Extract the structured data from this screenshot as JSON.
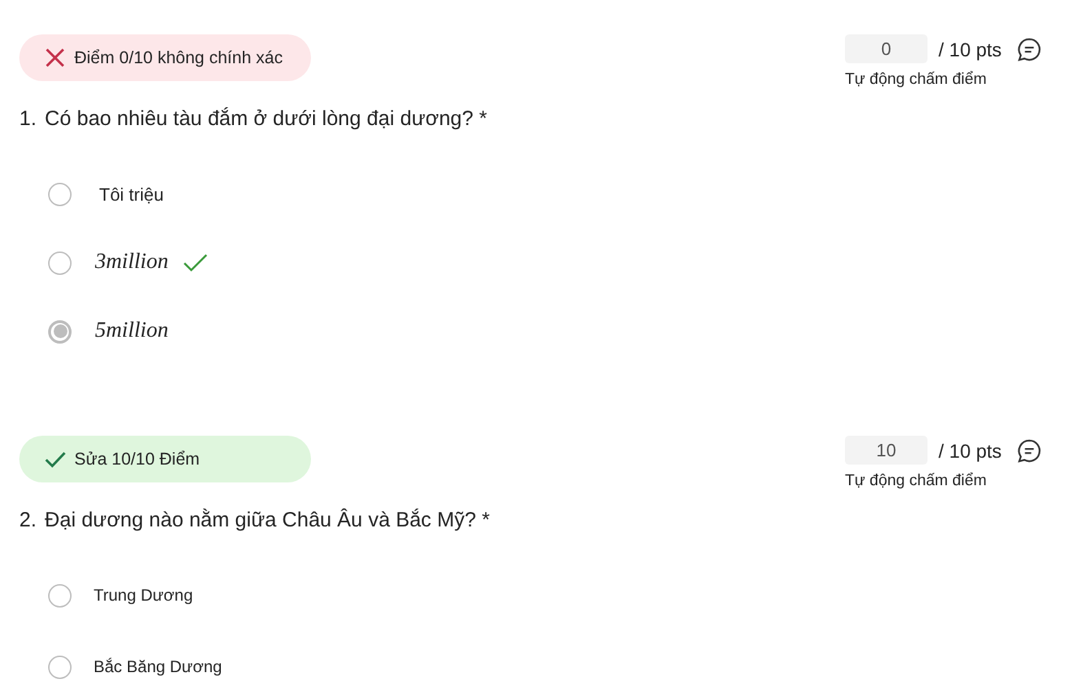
{
  "questions": [
    {
      "correct": false,
      "banner": "Điểm 0/10 không chính xác",
      "score": "0",
      "max": "/ 10 pts",
      "auto_grade": "Tự động chấm điểm",
      "number": "1.",
      "text": "Có bao nhiêu tàu đắm ở dưới lòng đại dương? *",
      "options": [
        {
          "label": "Tôi triệu",
          "kind": "plain",
          "selected": false,
          "correct": false
        },
        {
          "label": "3million",
          "kind": "math",
          "selected": false,
          "correct": true
        },
        {
          "label": "5million",
          "kind": "math",
          "selected": true,
          "correct": false
        }
      ]
    },
    {
      "correct": true,
      "banner": "Sửa 10/10 Điểm",
      "score": "10",
      "max": "/ 10 pts",
      "auto_grade": "Tự động chấm điểm",
      "number": "2.",
      "text": "Đại dương nào nằm giữa Châu Âu và Bắc Mỹ? *",
      "options": [
        {
          "label": "Trung Dương",
          "kind": "small",
          "selected": false,
          "correct": false
        },
        {
          "label": "Bắc Băng Dương",
          "kind": "small",
          "selected": false,
          "correct": false
        }
      ]
    }
  ]
}
